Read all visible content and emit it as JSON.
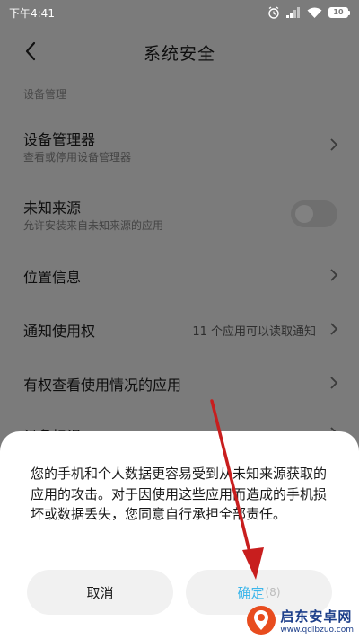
{
  "status_bar": {
    "time": "下午4:41",
    "battery": "10"
  },
  "header": {
    "title": "系统安全"
  },
  "sections": [
    {
      "header": "设备管理"
    }
  ],
  "rows": {
    "device_manager": {
      "title": "设备管理器",
      "subtitle": "查看或停用设备管理器"
    },
    "unknown_sources": {
      "title": "未知来源",
      "subtitle": "允许安装来自未知来源的应用",
      "enabled": false
    },
    "location": {
      "title": "位置信息"
    },
    "notification_access": {
      "title": "通知使用权",
      "value": "11 个应用可以读取通知"
    },
    "usage_access": {
      "title": "有权查看使用情况的应用"
    },
    "partial_row": {
      "title": "设备标识"
    }
  },
  "dialog": {
    "message": "您的手机和个人数据更容易受到从未知来源获取的应用的攻击。对于因使用这些应用而造成的手机损坏或数据丢失，您同意自行承担全部责任。",
    "cancel_label": "取消",
    "confirm_label": "确定",
    "confirm_countdown": "(8)"
  },
  "watermark": {
    "brand": "启东安卓网",
    "url": "www.qdlbzuo.com"
  },
  "colors": {
    "accent": "#3db6ea",
    "annotation": "#c81e1e",
    "overlay": "#7b7b7b"
  }
}
